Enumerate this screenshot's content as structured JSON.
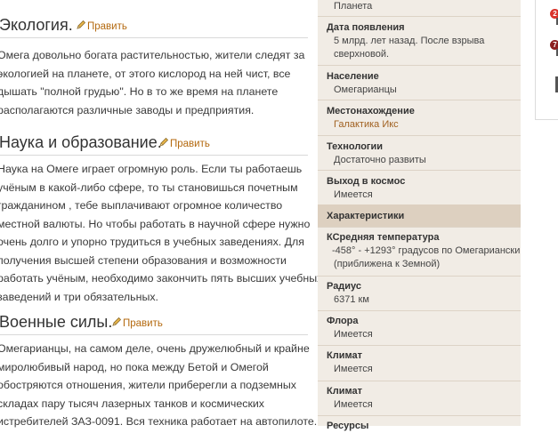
{
  "article": {
    "edit_label": "Править",
    "sections": [
      {
        "title": "Экология.",
        "lines": [
          "Омега довольно богата растительностью, жители следят за",
          "экологией на планете, от этого кислород на ней чист, все",
          "дышать \"полной грудью\". Но в то же время на планете",
          "располагаются различные заводы и предприятия."
        ]
      },
      {
        "title": "Наука и образование.",
        "lines": [
          "Наука на Омеге играет огромную роль. Если ты работаешь",
          "учёным в какой-либо сфере, то ты становишься почетным",
          "гражданином , тебе выплачивают огромное количество",
          "местной валюты. Но чтобы работать в научной сфере нужно",
          "очень долго и упорно трудиться в учебных заведениях. Для",
          "получения высшей степени образования и возможности",
          "работать учёным, необходимо закончить пять высших учебных",
          "заведений и три обязательных."
        ]
      },
      {
        "title": "Военные силы.",
        "lines": [
          "Омегарианцы, на самом деле, очень дружелюбный и крайне",
          "миролюбивый народ, но пока между Бетой и Омегой",
          "обостряются отношения, жители приберегли а подземных",
          "складах пару тысяч лазерных танков и космических",
          "истребителей ЗАЗ-0091. Вся техника работает на автопилоте."
        ]
      }
    ]
  },
  "infobox": {
    "rows": [
      {
        "key": "",
        "value": [
          "Планета"
        ]
      },
      {
        "key": "Дата появления",
        "value": [
          "5 млрд. лет назад. После взрыва",
          "сверхновой."
        ]
      },
      {
        "key": "Население",
        "value": [
          "Омегарианцы"
        ]
      },
      {
        "key": "Местонахождение",
        "value": [
          "Галактика Икс"
        ],
        "link": true
      },
      {
        "key": "Технологии",
        "value": [
          "Достаточно развиты"
        ]
      },
      {
        "key": "Выход в космос",
        "value": [
          "Имеется"
        ]
      },
      {
        "key": "Характеристики",
        "value": [],
        "header": true
      },
      {
        "key": "КСредняя температура",
        "value": [
          "-458° - +1293° градусов по Омегариански",
          "(приближена к Земной)"
        ]
      },
      {
        "key": "Радиус",
        "value": [
          "6371 км"
        ]
      },
      {
        "key": "Флора",
        "value": [
          "Имеется"
        ]
      },
      {
        "key": "Климат",
        "value": [
          "Имеется"
        ]
      },
      {
        "key": "Климат",
        "value": [
          "Имеется"
        ]
      },
      {
        "key": "Ресурсы",
        "value": []
      }
    ]
  },
  "rightpanel": {
    "badges": [
      {
        "text": "2",
        "color": "#d9332b"
      },
      {
        "text": "7",
        "color": "#8b1e1e"
      }
    ]
  }
}
